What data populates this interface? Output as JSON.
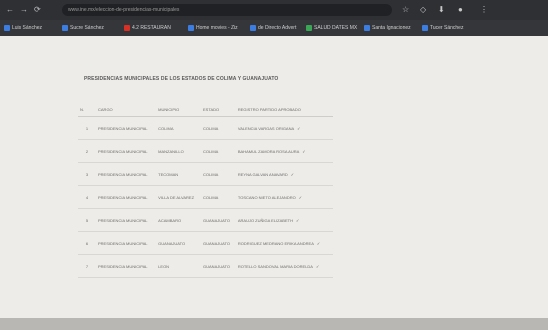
{
  "browser": {
    "url": "www.ine.mx/eleccion-de-presidencias-municipales",
    "nav_back": "←",
    "nav_forward": "→",
    "nav_reload": "⟳",
    "star": "☆",
    "menu": "⋮"
  },
  "bookmarks": [
    {
      "label": "Luis Sánchez",
      "color": "#3b7de0"
    },
    {
      "label": "Sucre Sánchez",
      "color": "#3b7de0"
    },
    {
      "label": "4.2 RESTAURAN",
      "color": "#d93025"
    },
    {
      "label": "Home movies - Ziz",
      "color": "#3b7de0"
    },
    {
      "label": "de Directo Advert",
      "color": "#3b7de0"
    },
    {
      "label": "SALUD DATES MX",
      "color": "#3aa757"
    },
    {
      "label": "Santa Ignacionez",
      "color": "#3b7de0"
    },
    {
      "label": "Tucer Sánchez",
      "color": "#3b7de0"
    }
  ],
  "document": {
    "title": "PRESIDENCIAS MUNICIPALES DE LOS ESTADOS DE COLIMA Y GUANAJUATO",
    "columns": [
      "N.",
      "CARGO",
      "MUNICIPIO",
      "ESTADO",
      "REGISTRO PARTIDO APROBADO"
    ],
    "rows": [
      {
        "n": "1",
        "cargo": "PRESIDENCIA MUNICIPAL",
        "municipio": "COLIMA",
        "estado": "COLIMA",
        "registro": "VALENCIA VARGAS ORIGANA",
        "mark": "✓"
      },
      {
        "n": "2",
        "cargo": "PRESIDENCIA MUNICIPAL",
        "municipio": "MANZANILLO",
        "estado": "COLIMA",
        "registro": "BAHAMUL ZAMORA ROSA AURA",
        "mark": "✓"
      },
      {
        "n": "3",
        "cargo": "PRESIDENCIA MUNICIPAL",
        "municipio": "TECOMAN",
        "estado": "COLIMA",
        "registro": "REYNA GALVAN ANAVARD",
        "mark": "✓"
      },
      {
        "n": "4",
        "cargo": "PRESIDENCIA MUNICIPAL",
        "municipio": "VILLA DE ALVAREZ",
        "estado": "COLIMA",
        "registro": "TOSCANO NIETO ALEJANDRO",
        "mark": "✓"
      },
      {
        "n": "5",
        "cargo": "PRESIDENCIA MUNICIPAL",
        "municipio": "ACAMBARO",
        "estado": "GUANAJUATO",
        "registro": "ARAUJO ZUÑIGA ELIZABETH",
        "mark": "✓"
      },
      {
        "n": "6",
        "cargo": "PRESIDENCIA MUNICIPAL",
        "municipio": "GUANAJUATO",
        "estado": "GUANAJUATO",
        "registro": "RODRIGUEZ MEDRANO ERIKA ANDREA",
        "mark": "✓"
      },
      {
        "n": "7",
        "cargo": "PRESIDENCIA MUNICIPAL",
        "municipio": "LEON",
        "estado": "GUANAJUATO",
        "registro": "ROTELLO SANDOVAL MARIA DORELDA",
        "mark": "✓"
      }
    ]
  }
}
